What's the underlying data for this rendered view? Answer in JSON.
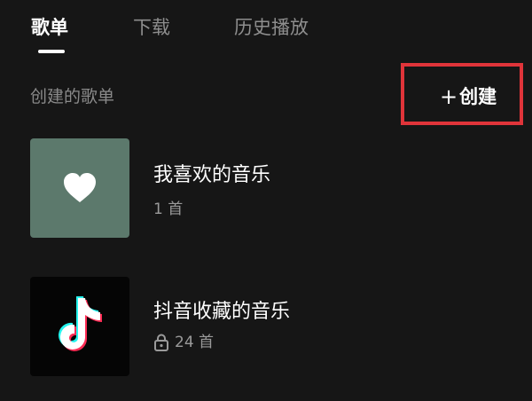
{
  "tabs": [
    {
      "label": "歌单",
      "active": true
    },
    {
      "label": "下载",
      "active": false
    },
    {
      "label": "历史播放",
      "active": false
    }
  ],
  "section": {
    "title": "创建的歌单",
    "create_label": "创建",
    "create_icon": "plus-icon",
    "highlight_color": "#e0343a"
  },
  "playlists": [
    {
      "title": "我喜欢的音乐",
      "count": "1 首",
      "icon": "heart-icon",
      "cover_color": "#5c796c",
      "locked": false
    },
    {
      "title": "抖音收藏的音乐",
      "count": "24 首",
      "icon": "douyin-logo-icon",
      "cover_color": "#050505",
      "locked": true
    }
  ]
}
